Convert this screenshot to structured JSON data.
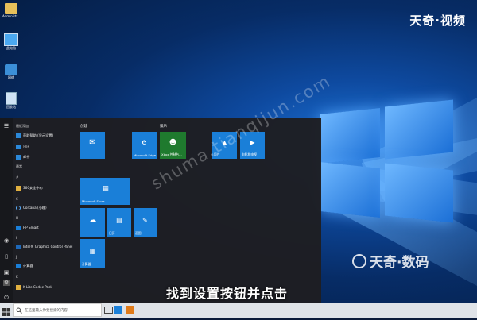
{
  "desktop": {
    "icons": [
      {
        "label": "Administr...",
        "icon": "folder-user-icon"
      },
      {
        "label": "此电脑",
        "icon": "this-pc-icon"
      },
      {
        "label": "网络",
        "icon": "network-icon"
      },
      {
        "label": "回收站",
        "icon": "recycle-bin-icon"
      }
    ]
  },
  "watermarks": {
    "top_right": "天奇·视频",
    "diagonal": "shuma.tianqijun.com",
    "bottom_right": "天奇·数码"
  },
  "subtitle": "找到设置按钮并点击",
  "start_menu": {
    "rail_icons": [
      "hamburger-menu-icon",
      "user-icon",
      "documents-icon",
      "pictures-icon",
      "settings-gear-icon",
      "power-icon"
    ],
    "groups": [
      {
        "label": "最近添加"
      },
      {
        "label": "最常"
      },
      {
        "label": "#"
      },
      {
        "label": "C"
      },
      {
        "label": "H"
      },
      {
        "label": "I"
      },
      {
        "label": "J"
      },
      {
        "label": "K"
      }
    ],
    "apps": [
      {
        "label": "获取帮助 (显示设置)",
        "icon": "help-icon"
      },
      {
        "label": "日历",
        "icon": "calendar-icon"
      },
      {
        "label": "邮件",
        "icon": "mail-icon"
      },
      {
        "label": "360安全中心",
        "icon": "folder-icon"
      },
      {
        "label": "Cortana (小娜)",
        "icon": "cortana-icon"
      },
      {
        "label": "HP Smart",
        "icon": "hp-icon"
      },
      {
        "label": "Intel® Graphics Control Panel",
        "icon": "intel-icon"
      },
      {
        "label": "计算器",
        "icon": "calculator-icon"
      },
      {
        "label": "K-Lite Codec Pack",
        "icon": "folder-icon"
      }
    ],
    "sections": {
      "create": "创建",
      "play": "娱乐"
    },
    "tiles": [
      {
        "label": "",
        "icon": "mail-icon"
      },
      {
        "label": "Microsoft Edge",
        "icon": "edge-icon"
      },
      {
        "label": "Xbox 控制台...",
        "icon": "xbox-icon"
      },
      {
        "label": "照片",
        "icon": "photos-icon"
      },
      {
        "label": "电影和电视",
        "icon": "movies-icon"
      },
      {
        "label": "Microsoft Store",
        "icon": "store-icon"
      },
      {
        "label": "",
        "icon": "onedrive-icon"
      },
      {
        "label": "日历",
        "icon": "calendar-icon"
      },
      {
        "label": "画图",
        "icon": "paint-icon"
      },
      {
        "label": "计算器",
        "icon": "calculator-icon"
      }
    ]
  },
  "taskbar": {
    "search_placeholder": "在这里输入你要搜索的内容",
    "apps": [
      "start-icon",
      "edge-icon",
      "store-icon",
      "explorer-icon",
      "browser-icon",
      "orange-app-icon"
    ]
  },
  "colors": {
    "tile_blue": "#1a7fd8",
    "start_menu_bg": "#1e1e22",
    "taskbar_bg": "#dfe3e8"
  }
}
